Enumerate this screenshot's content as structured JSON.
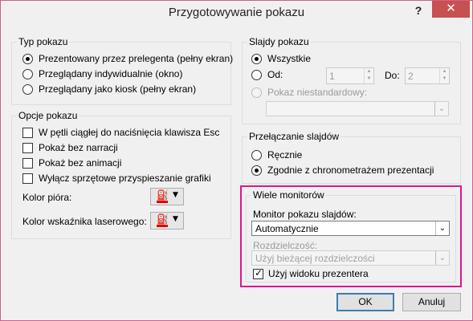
{
  "title": "Przygotowywanie pokazu",
  "help_label": "?",
  "close_label": "✕",
  "show_type": {
    "legend": "Typ pokazu",
    "options": [
      {
        "label": "Prezentowany przez prelegenta (pełny ekran)",
        "selected": true
      },
      {
        "label": "Przeglądany indywidualnie (okno)",
        "selected": false
      },
      {
        "label": "Przeglądany jako kiosk (pełny ekran)",
        "selected": false
      }
    ]
  },
  "show_options": {
    "legend": "Opcje pokazu",
    "checks": [
      {
        "label": "W pętli ciągłej do naciśnięcia klawisza Esc",
        "checked": false
      },
      {
        "label": "Pokaż bez narracji",
        "checked": false
      },
      {
        "label": "Pokaż bez animacji",
        "checked": false
      },
      {
        "label": "Wyłącz sprzętowe przyspieszanie grafiki",
        "checked": false
      }
    ],
    "pen_color_label": "Kolor pióra:",
    "laser_color_label": "Kolor wskaźnika laserowego:",
    "pen_color": "#e00000",
    "laser_color": "#e00000",
    "color_icon": "paint-bucket-icon"
  },
  "slides": {
    "legend": "Slajdy pokazu",
    "all_label": "Wszystkie",
    "from_label": "Od:",
    "from_value": "1",
    "to_label": "Do:",
    "to_value": "2",
    "custom_label": "Pokaz niestandardowy:",
    "custom_value": ""
  },
  "advance": {
    "legend": "Przełączanie slajdów",
    "manual_label": "Ręcznie",
    "timings_label": "Zgodnie z chronometrażem prezentacji"
  },
  "monitors": {
    "legend": "Wiele monitorów",
    "monitor_label": "Monitor pokazu slajdów:",
    "monitor_value": "Automatycznie",
    "resolution_label": "Rozdzielczość:",
    "resolution_value": "Użyj bieżącej rozdzielczości",
    "presenter_view_label": "Użyj widoku prezentera",
    "presenter_view_checked": true,
    "highlight_color": "#e0168c"
  },
  "buttons": {
    "ok": "OK",
    "cancel": "Anuluj"
  }
}
